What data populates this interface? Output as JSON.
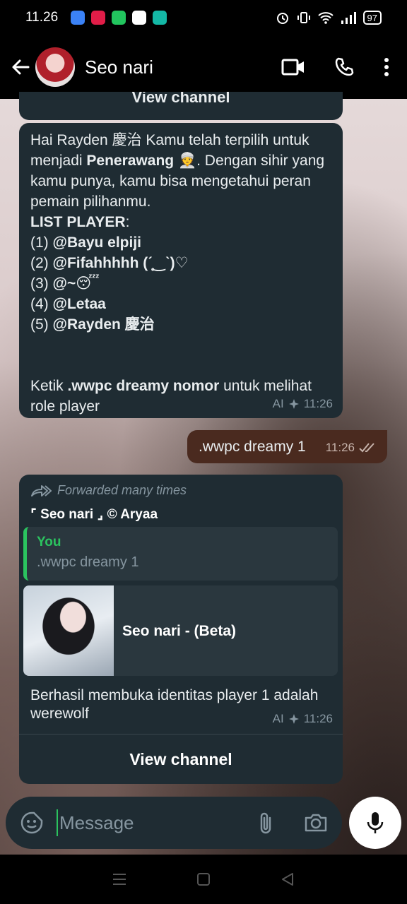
{
  "status_bar": {
    "time": "11.26",
    "battery": "97",
    "app_icon_colors": [
      "#3b82f6",
      "#e11d48",
      "#22c55e",
      "#ffffff",
      "#14b8a6"
    ]
  },
  "header": {
    "contact_name": "Seo nari",
    "icons": [
      "back-arrow-icon",
      "video-call-icon",
      "phone-icon",
      "more-vert-icon"
    ]
  },
  "messages": {
    "prev_partial": "View channel",
    "m1": {
      "greeting": "Hai Rayden 慶治 Kamu telah terpilih  untuk menjadi ",
      "role": "Penerawang",
      "emoji_role": "👳",
      "after_role": ". Dengan sihir yang kamu punya, kamu bisa mengetahui peran pemain pilihanmu.",
      "list_title": "LIST PLAYER",
      "list_colon": ":",
      "players": [
        {
          "num": "(1) ",
          "name": "@Bayu elpiji"
        },
        {
          "num": "(2) ",
          "name": "@Fifahhhhh (ˊ̥̥‿ˋ)♡"
        },
        {
          "num": "(3) ",
          "name": "@~😴"
        },
        {
          "num": "(4) ",
          "name": "@Letaa"
        },
        {
          "num": "(5) ",
          "name": "@Rayden 慶治"
        }
      ],
      "instruction_pre": "Ketik ",
      "instruction_cmd": ".wwpc dreamy nomor",
      "instruction_post": " untuk melihat role player",
      "meta_label": "AI",
      "time": "11:26"
    },
    "outgoing": {
      "text": ".wwpc dreamy 1",
      "time": "11:26",
      "status": "read"
    },
    "m3": {
      "forwarded_label": "Forwarded many times",
      "channel_title": "⌜ Seo nari ⌟ © Aryaa",
      "quote_author": "You",
      "quote_text": ".wwpc dreamy 1",
      "preview_title": "Seo nari - (Beta)",
      "body": "Berhasil membuka identitas player 1 adalah werewolf",
      "meta_label": "AI",
      "time": "11:26",
      "action": "View channel"
    }
  },
  "composer": {
    "placeholder": "Message"
  }
}
